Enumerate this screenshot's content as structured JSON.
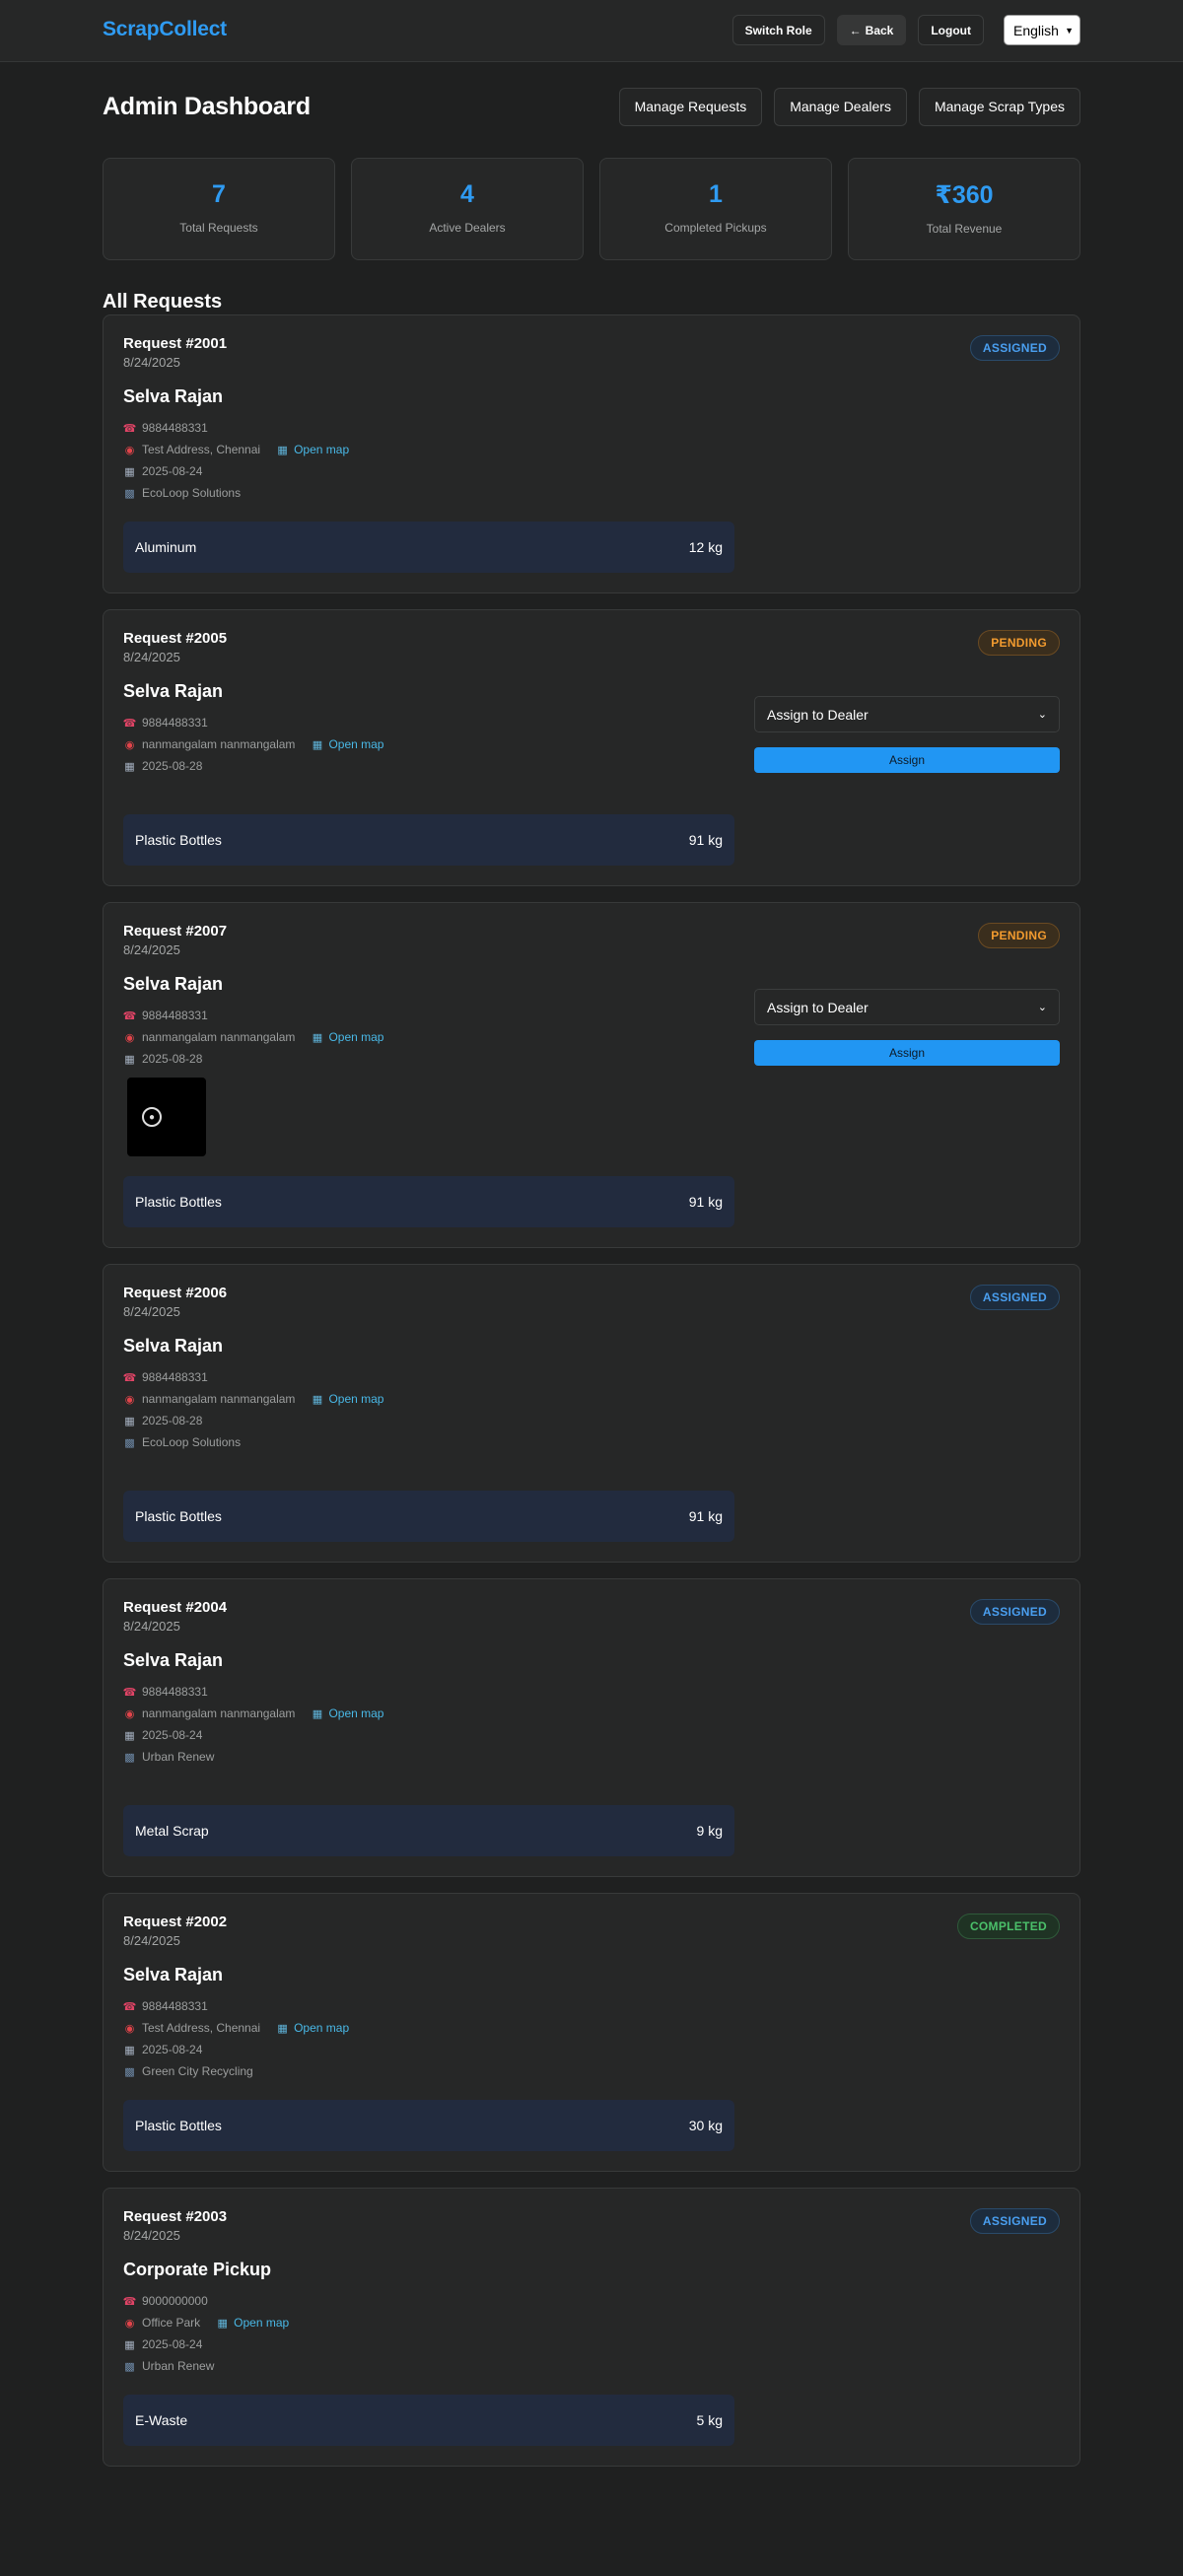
{
  "header": {
    "brand": "ScrapCollect",
    "switch_role": "Switch Role",
    "back": "Back",
    "back_arrow": "←",
    "logout": "Logout",
    "language": "English"
  },
  "page": {
    "title": "Admin Dashboard",
    "manage_requests": "Manage Requests",
    "manage_dealers": "Manage Dealers",
    "manage_scrap_types": "Manage Scrap Types",
    "section_title": "All Requests"
  },
  "stats": [
    {
      "value": "7",
      "label": "Total Requests"
    },
    {
      "value": "4",
      "label": "Active Dealers"
    },
    {
      "value": "1",
      "label": "Completed Pickups"
    },
    {
      "value": "₹360",
      "label": "Total Revenue"
    }
  ],
  "open_map_label": "Open map",
  "assign_select_label": "Assign to Dealer",
  "assign_button_label": "Assign",
  "requests": [
    {
      "id": "Request #2001",
      "date": "8/24/2025",
      "status": "ASSIGNED",
      "customer": "Selva Rajan",
      "phone": "9884488331",
      "address": "Test Address, Chennai",
      "pickup_date": "2025-08-24",
      "dealer": "EcoLoop Solutions",
      "item": "Aluminum",
      "qty": "12 kg"
    },
    {
      "id": "Request #2005",
      "date": "8/24/2025",
      "status": "PENDING",
      "customer": "Selva Rajan",
      "phone": "9884488331",
      "address": "nanmangalam nanmangalam",
      "pickup_date": "2025-08-28",
      "item": "Plastic Bottles",
      "qty": "91 kg"
    },
    {
      "id": "Request #2007",
      "date": "8/24/2025",
      "status": "PENDING",
      "customer": "Selva Rajan",
      "phone": "9884488331",
      "address": "nanmangalam nanmangalam",
      "pickup_date": "2025-08-28",
      "item": "Plastic Bottles",
      "qty": "91 kg"
    },
    {
      "id": "Request #2006",
      "date": "8/24/2025",
      "status": "ASSIGNED",
      "customer": "Selva Rajan",
      "phone": "9884488331",
      "address": "nanmangalam nanmangalam",
      "pickup_date": "2025-08-28",
      "dealer": "EcoLoop Solutions",
      "item": "Plastic Bottles",
      "qty": "91 kg"
    },
    {
      "id": "Request #2004",
      "date": "8/24/2025",
      "status": "ASSIGNED",
      "customer": "Selva Rajan",
      "phone": "9884488331",
      "address": "nanmangalam nanmangalam",
      "pickup_date": "2025-08-24",
      "dealer": "Urban Renew",
      "item": "Metal Scrap",
      "qty": "9 kg"
    },
    {
      "id": "Request #2002",
      "date": "8/24/2025",
      "status": "COMPLETED",
      "customer": "Selva Rajan",
      "phone": "9884488331",
      "address": "Test Address, Chennai",
      "pickup_date": "2025-08-24",
      "dealer": "Green City Recycling",
      "item": "Plastic Bottles",
      "qty": "30 kg"
    },
    {
      "id": "Request #2003",
      "date": "8/24/2025",
      "status": "ASSIGNED",
      "customer": "Corporate Pickup",
      "phone": "9000000000",
      "address": "Office Park",
      "pickup_date": "2025-08-24",
      "dealer": "Urban Renew",
      "item": "E-Waste",
      "qty": "5 kg"
    }
  ]
}
